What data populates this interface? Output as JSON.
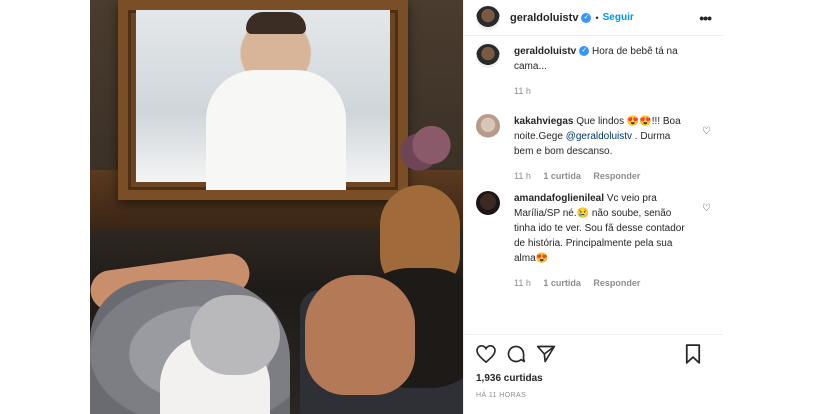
{
  "post": {
    "username": "geraldoluistv",
    "follow_label": "Seguir",
    "more_label": "•••",
    "separator": "•"
  },
  "caption": {
    "username": "geraldoluistv",
    "text": "Hora de bebê tá na cama...",
    "time": "11 h"
  },
  "comments": [
    {
      "username": "kakahviegas",
      "text_before": "Que lindos 😍😍!!! Boa noite.Gege ",
      "mention": "@geraldoluistv",
      "text_after": " . Durma bem e bom descanso.",
      "time": "11 h",
      "likes": "1 curtida",
      "reply": "Responder"
    },
    {
      "username": "amandafoglienileal",
      "text": "Vc veio pra Marília/SP né.😢 não soube, senão tinha ido te ver. Sou fã desse contador de história. Principalmente pela sua alma😍",
      "time": "11 h",
      "likes": "1 curtida",
      "reply": "Responder"
    }
  ],
  "footer": {
    "likes": "1,936 curtidas",
    "timestamp": "HÁ 11 HORAS"
  },
  "icons": {
    "like": "heart-icon",
    "comment": "comment-icon",
    "share": "share-icon",
    "save": "bookmark-icon"
  }
}
